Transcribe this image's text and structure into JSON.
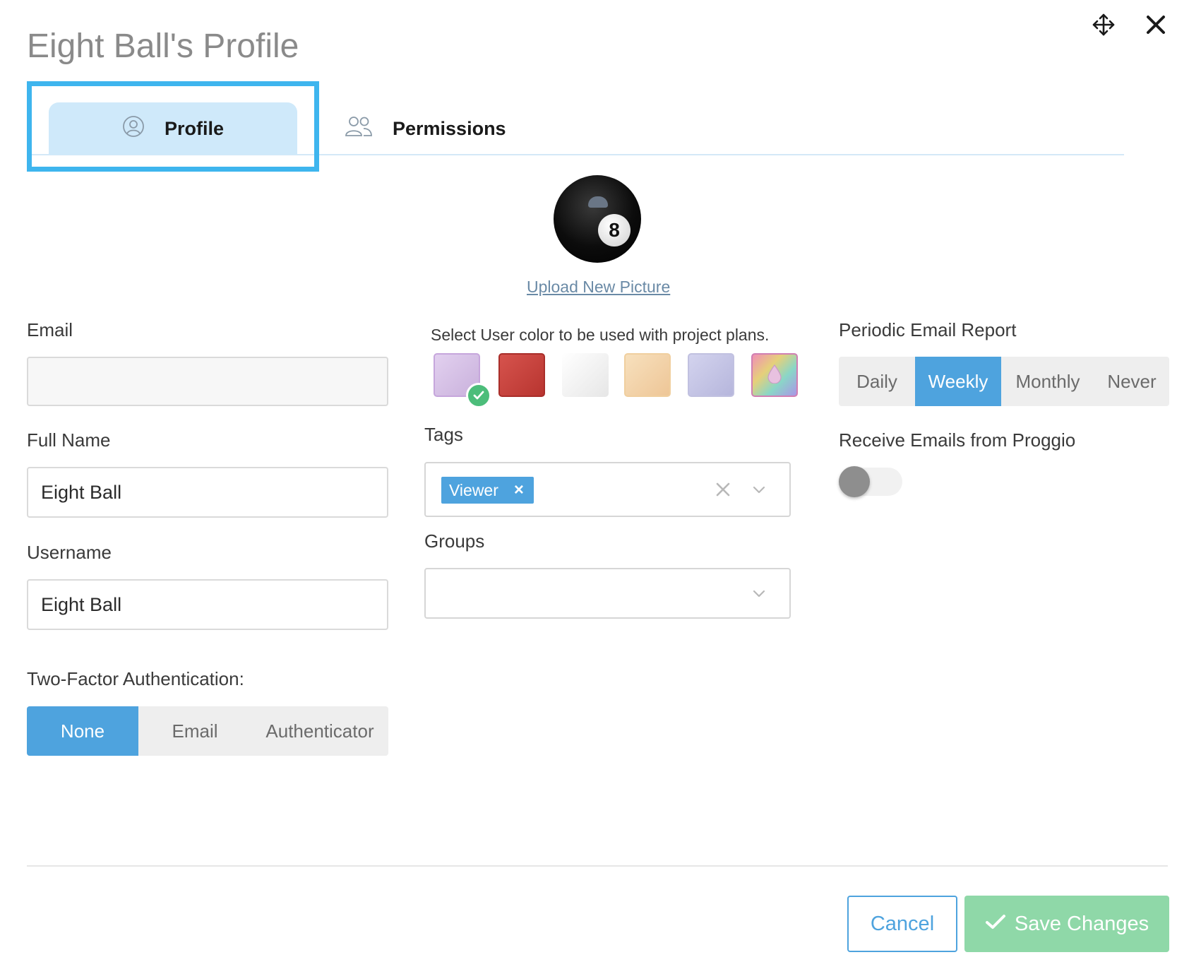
{
  "dialog": {
    "title": "Eight Ball's Profile"
  },
  "icons": {
    "move": "move-arrows-icon",
    "close": "close-icon",
    "profile_tab": "user-circle-icon",
    "permissions_tab": "users-icon",
    "check": "check-icon",
    "chevron": "chevron-down-icon",
    "clear": "clear-x-icon"
  },
  "tabs": [
    {
      "label": "Profile",
      "active": true
    },
    {
      "label": "Permissions",
      "active": false
    }
  ],
  "avatar": {
    "number": "8",
    "upload_label": "Upload New Picture"
  },
  "fields": {
    "email": {
      "label": "Email",
      "value": ""
    },
    "full_name": {
      "label": "Full Name",
      "value": "Eight Ball"
    },
    "username": {
      "label": "Username",
      "value": "Eight Ball"
    }
  },
  "two_factor": {
    "label": "Two-Factor Authentication:",
    "options": [
      "None",
      "Email",
      "Authenticator"
    ],
    "selected": "None"
  },
  "user_color": {
    "hint": "Select User color to be used with project plans.",
    "swatches": [
      {
        "color": "#d7c3e6",
        "selected": true
      },
      {
        "color": "#c9443f",
        "selected": false
      },
      {
        "color": "#f0f0f0",
        "selected": false
      },
      {
        "color": "#f3d3a8",
        "selected": false
      },
      {
        "color": "#c5c5e6",
        "selected": false
      },
      {
        "color": "#e8b3cf",
        "selected": false,
        "type": "custom-picker"
      }
    ]
  },
  "tags": {
    "label": "Tags",
    "values": [
      "Viewer"
    ]
  },
  "groups": {
    "label": "Groups",
    "value": ""
  },
  "periodic_report": {
    "label": "Periodic Email Report",
    "options": [
      "Daily",
      "Weekly",
      "Monthly",
      "Never"
    ],
    "selected": "Weekly"
  },
  "receive_emails": {
    "label": "Receive Emails from Proggio",
    "enabled": false
  },
  "footer": {
    "cancel_label": "Cancel",
    "save_label": "Save Changes"
  },
  "colors": {
    "accent": "#4ea3de",
    "tab_highlight": "#3eb5ee",
    "save_button": "#8fd8a8",
    "check_badge": "#4cbd7a"
  }
}
